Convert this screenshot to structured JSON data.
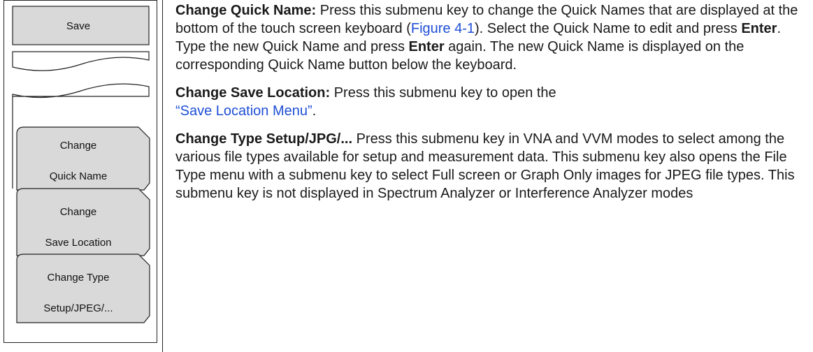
{
  "menu": {
    "save_label": "Save",
    "change_quick_name": [
      "Change",
      "Quick Name"
    ],
    "change_save_location": [
      "Change",
      "Save Location"
    ],
    "change_type": [
      "Change Type",
      "Setup/JPEG/..."
    ]
  },
  "descriptions": {
    "quick_name": {
      "title": "Change Quick Name:",
      "t1": " Press this submenu key to change the Quick Names that are displayed at the bottom of the touch screen keyboard (",
      "link": "Figure 4-1",
      "t2": "). Select the Quick Name to edit and press ",
      "enter1": "Enter",
      "t3": ". Type the new Quick Name and press ",
      "enter2": "Enter",
      "t4": " again. The new Quick Name is displayed on the corresponding Quick Name button below the keyboard."
    },
    "save_location": {
      "title": "Change Save Location:",
      "t1": " Press this submenu key to open the ",
      "link": "“Save Location Menu”",
      "t2": "."
    },
    "type_setup": {
      "title": "Change Type Setup/JPG/...",
      "t1": " Press this submenu key in VNA and VVM modes to select among the various file types available for setup and measurement data. This submenu key also opens the File Type menu with a submenu key to select Full screen or Graph Only images for JPEG file types. This submenu key is not displayed in Spectrum Analyzer or Interference Analyzer modes"
    }
  },
  "colors": {
    "key_fill": "#d9d9d9",
    "link": "#1f4fd6",
    "outline": "#222222"
  }
}
